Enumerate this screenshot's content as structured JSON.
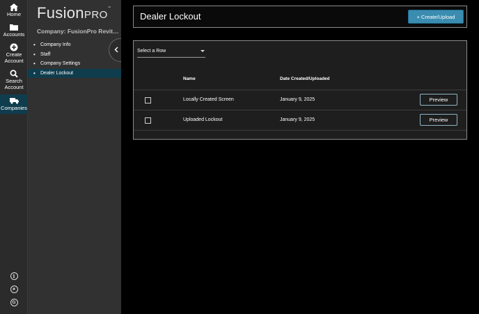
{
  "rail": {
    "items": [
      {
        "label": "Home",
        "icon": "home-icon"
      },
      {
        "label": "Accounts",
        "icon": "folder-icon"
      },
      {
        "label": "Create Account",
        "icon": "plus-circle-icon"
      },
      {
        "label": "Search Account",
        "icon": "search-icon"
      },
      {
        "label": "Companies",
        "icon": "truck-icon",
        "active": true
      }
    ],
    "bottom": [
      {
        "glyph": "i",
        "icon": "info-icon"
      },
      {
        "glyph": "✶",
        "icon": "gear-icon"
      },
      {
        "glyph": "G",
        "icon": "g-circle-icon"
      }
    ]
  },
  "sidebar": {
    "logo_main": "Fusion",
    "logo_sub": "PRO",
    "logo_tm": "™",
    "company": "Company: FusionPro Revitali...",
    "items": [
      {
        "label": "Company Info"
      },
      {
        "label": "Staff"
      },
      {
        "label": "Company Settings"
      },
      {
        "label": "Dealer Lockout",
        "active": true
      }
    ]
  },
  "header": {
    "title": "Dealer Lockout",
    "create_label": "+ Create/Upload",
    "accent": "#3a8db0"
  },
  "table": {
    "select_label": "Select a Row",
    "columns": {
      "name": "Name",
      "date": "Date Created/Uploaded"
    },
    "rows": [
      {
        "name": "Locally Created Screen",
        "date": "January 9, 2025",
        "action": "Preview"
      },
      {
        "name": "Uploaded Lockout",
        "date": "January 9, 2025",
        "action": "Preview"
      }
    ]
  }
}
